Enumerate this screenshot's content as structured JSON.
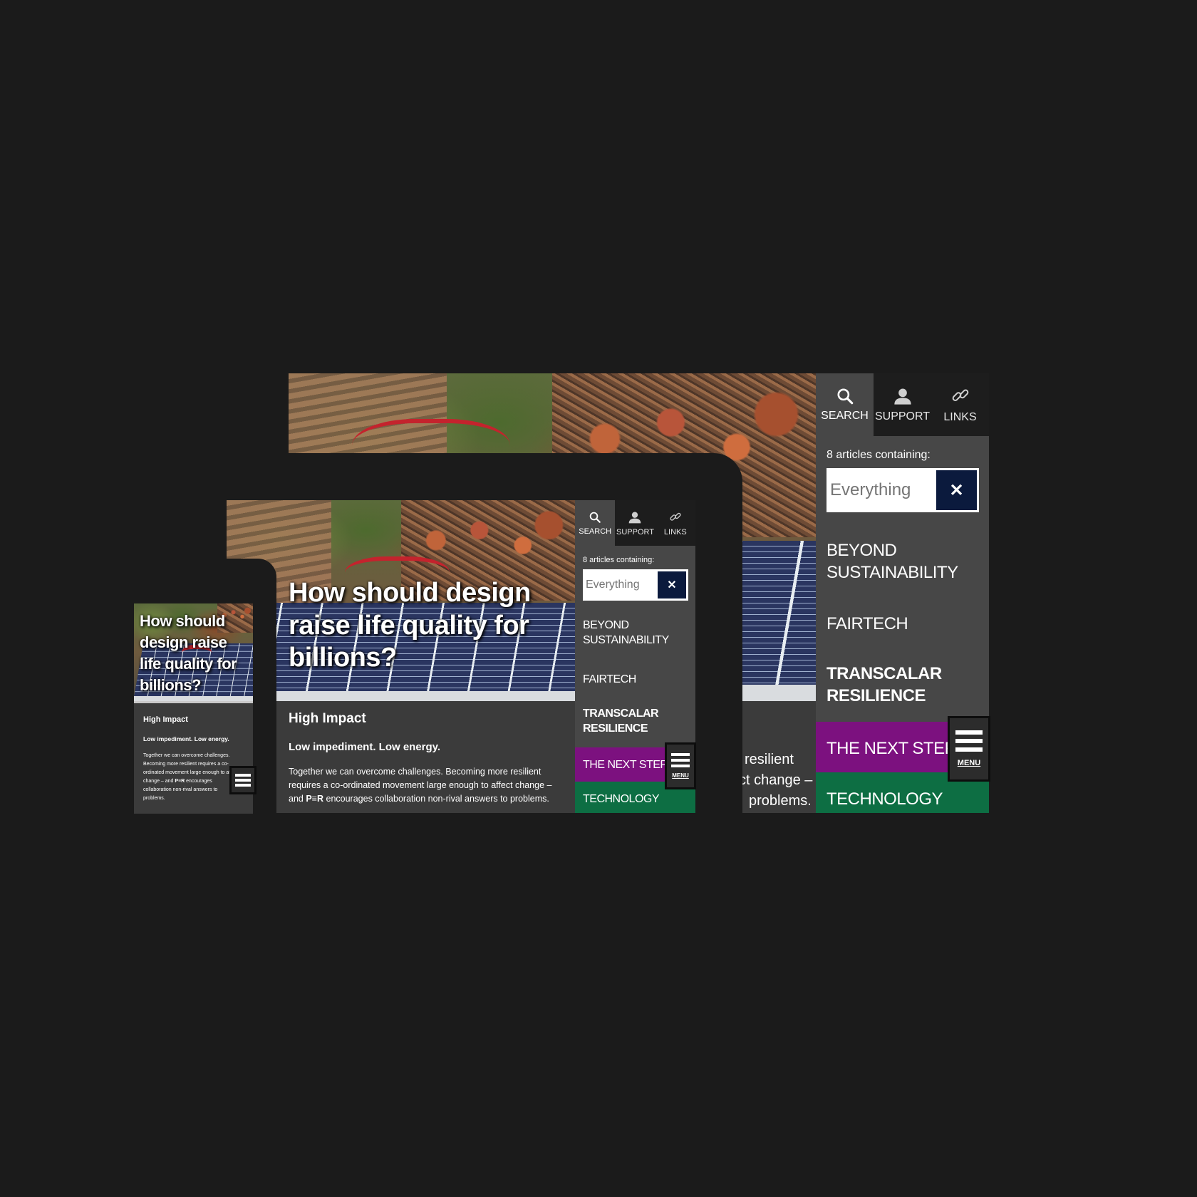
{
  "nav": {
    "tabs": [
      {
        "label": "SEARCH",
        "icon": "search-icon"
      },
      {
        "label": "SUPPORT",
        "icon": "user-icon"
      },
      {
        "label": "LINKS",
        "icon": "link-icon"
      }
    ],
    "articles_count": "8 articles containing:",
    "search_placeholder": "Everything",
    "clear_symbol": "✕",
    "items": [
      "BEYOND SUSTAINABILITY",
      "FAIRTECH",
      "TRANSCALAR RESILIENCE",
      "THE NEXT STEP",
      "TECHNOLOGY"
    ],
    "menu_label": "MENU"
  },
  "article": {
    "headline": "How should design raise life quality for billions?",
    "section": "High Impact",
    "subtitle": "Low impediment. Low energy.",
    "body_before": "Together we can overcome challenges. Becoming more resilient requires a co-ordinated movement large enough to affect change – and",
    "brand": "P≡R",
    "body_after": "encourages collaboration non-rival answers to problems.",
    "desktop_fragments": [
      "resilient",
      "ct change –",
      "problems."
    ]
  },
  "colors": {
    "background": "#1b1b1b",
    "purple": "#7c117f",
    "green": "#0d6e43",
    "navy": "#0b1a3d"
  }
}
